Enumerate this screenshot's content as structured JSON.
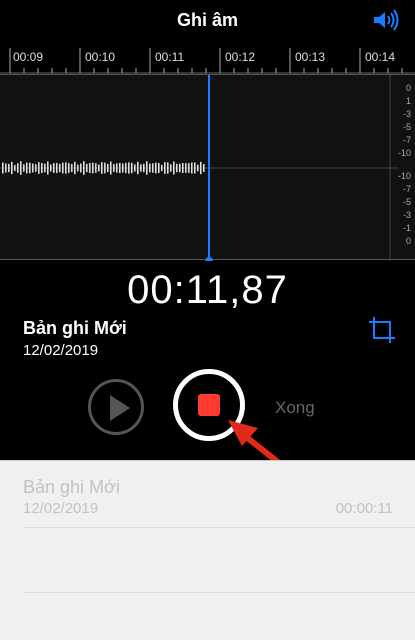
{
  "header": {
    "title": "Ghi âm",
    "speaker_icon": "speaker-icon"
  },
  "timeline": {
    "ticks": [
      "00:09",
      "00:10",
      "00:11",
      "00:12",
      "00:13",
      "00:14"
    ]
  },
  "waveform": {
    "db_top": [
      "0",
      "1",
      "-3",
      "-5",
      "-7",
      "-10"
    ],
    "db_center": [
      "-10",
      "-10"
    ],
    "db_bottom": [
      "-7",
      "-5",
      "-3",
      "-1",
      "0"
    ]
  },
  "recorder": {
    "elapsed": "00:11,87",
    "name": "Bản ghi Mới",
    "date": "12/02/2019",
    "done_label": "Xong",
    "accent_color": "#ff3b30",
    "playhead_color": "#1a7cff"
  },
  "list": {
    "items": [
      {
        "name": "Bản ghi Mới",
        "date": "12/02/2019",
        "duration": "00:00:11"
      }
    ]
  }
}
